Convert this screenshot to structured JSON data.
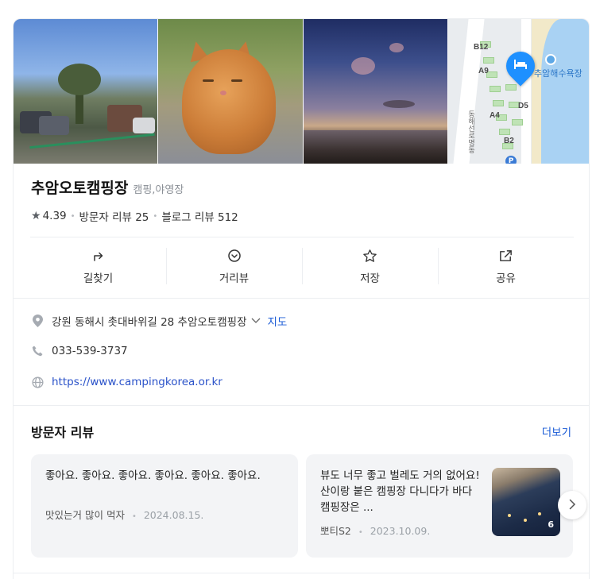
{
  "place": {
    "name": "추암오토캠핑장",
    "category": "캠핑,야영장",
    "rating": "4.39",
    "visitor_reviews": "방문자 리뷰 25",
    "blog_reviews": "블로그 리뷰 512"
  },
  "map_thumb": {
    "labels": [
      "B12",
      "A9",
      "A4",
      "D5",
      "B2"
    ],
    "beach_label": "추암해수욕장",
    "road_label": "동해선로명동",
    "parking": "P"
  },
  "actions": [
    {
      "label": "길찾기",
      "icon": "directions-icon"
    },
    {
      "label": "거리뷰",
      "icon": "street-view-icon"
    },
    {
      "label": "저장",
      "icon": "star-icon"
    },
    {
      "label": "공유",
      "icon": "share-icon"
    }
  ],
  "info": {
    "address": "강원 동해시 촛대바위길 28 추암오토캠핑장",
    "map_link": "지도",
    "phone": "033-539-3737",
    "website": "https://www.campingkorea.or.kr"
  },
  "reviews_section": {
    "title": "방문자 리뷰",
    "more": "더보기",
    "items": [
      {
        "text": "좋아요. 좋아요. 좋아요. 좋아요. 좋아요. 좋아요.",
        "author": "맛있는거 많이 먹자",
        "date": "2024.08.15."
      },
      {
        "text": "뷰도 너무 좋고 벌레도 거의 없어요! 산이랑 붙은 캠핑장 다니다가 바다 캠핑장은 ...",
        "author": "뽀티S2",
        "date": "2023.10.09.",
        "photo_count": "6"
      }
    ]
  },
  "colors": {
    "accent": "#1a5bd6",
    "map_pin": "#1e90ff"
  }
}
